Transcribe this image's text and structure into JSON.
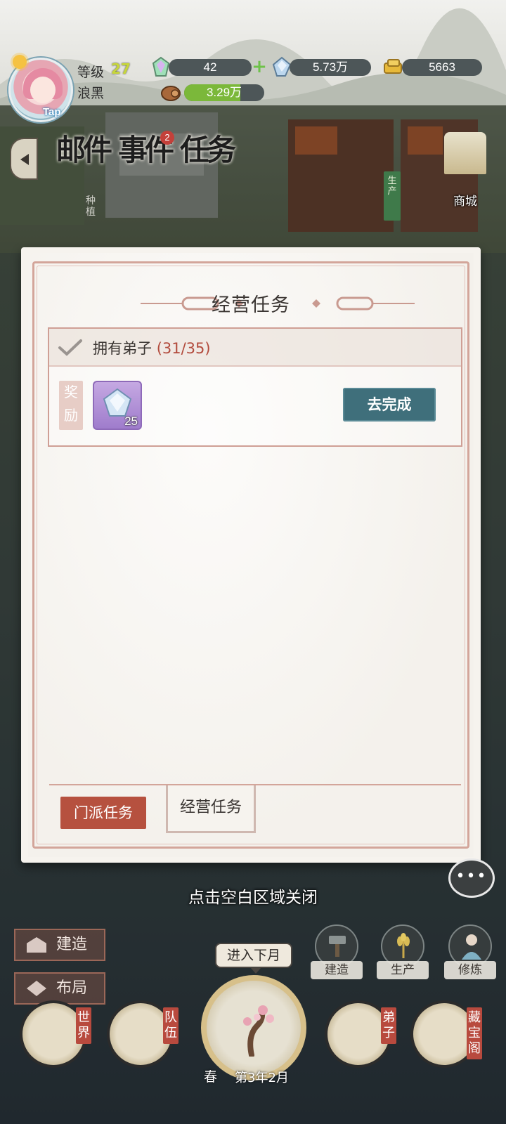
{
  "player": {
    "tap_label": "Tap",
    "level_label": "等级",
    "level_value": "27",
    "name": "浪黑"
  },
  "resources": {
    "spirit_stone": "42",
    "crystal": "5.73万",
    "gold": "5663",
    "wood": "3.29万",
    "wood_fill_pct": 0.7
  },
  "menu": {
    "mail": "邮件",
    "events": "事件",
    "events_badge": "2",
    "tasks": "任务",
    "plant": "种植",
    "produce_sign": "生产",
    "shop": "商城"
  },
  "panel": {
    "title": "经营任务",
    "task": {
      "name": "拥有弟子",
      "progress": "(31/35)",
      "reward_tag": "奖励",
      "reward_count": "25",
      "action": "去完成"
    },
    "tabs": {
      "sect": "门派任务",
      "business": "经营任务"
    }
  },
  "close_hint": "点击空白区域关闭",
  "hud": {
    "build_side": "建造",
    "layout_side": "布局",
    "build": "建造",
    "produce": "生产",
    "cultivate": "修炼",
    "next_month": "进入下月",
    "season": "春",
    "date": "第3年2月",
    "nav": {
      "world": "世界",
      "team": "队伍",
      "disciples": "弟子",
      "treasury": "藏宝阁"
    }
  },
  "colors": {
    "accent_red": "#b6513f",
    "action_teal": "#3f6f7b",
    "progress_red": "#b24a3c",
    "level_yellow": "#c7d63c"
  }
}
